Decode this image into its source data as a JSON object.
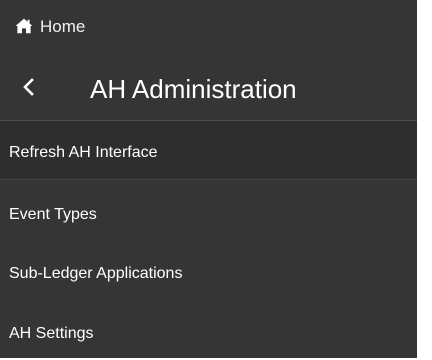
{
  "nav": {
    "home": {
      "icon": "home-icon",
      "label": "Home"
    },
    "back_icon": "chevron-left-icon",
    "title": "AH Administration",
    "items": [
      {
        "label": "Refresh AH Interface",
        "selected": true
      },
      {
        "label": "Event Types",
        "selected": false
      },
      {
        "label": "Sub-Ledger Applications",
        "selected": false
      },
      {
        "label": "AH Settings",
        "selected": false
      }
    ]
  },
  "colors": {
    "panel_background": "#353535",
    "selected_background": "#2e2e2e",
    "text": "#ffffff"
  }
}
